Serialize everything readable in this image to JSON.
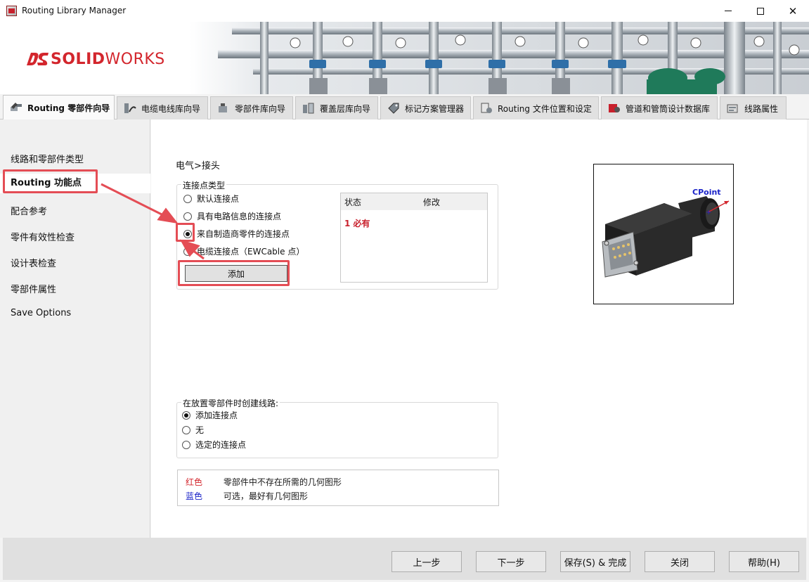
{
  "window": {
    "title": "Routing Library Manager"
  },
  "brand": {
    "logo_bold": "SOLID",
    "logo_light": "WORKS",
    "accent": "#d3262d"
  },
  "tabs": [
    {
      "label": "Routing 零部件向导",
      "icon": "routing-wizard-icon",
      "active": true
    },
    {
      "label": "电缆电线库向导",
      "icon": "cable-library-icon"
    },
    {
      "label": "零部件库向导",
      "icon": "component-library-icon"
    },
    {
      "label": "覆盖层库向导",
      "icon": "covering-library-icon"
    },
    {
      "label": "标记方案管理器",
      "icon": "tag-scheme-icon"
    },
    {
      "label": "Routing 文件位置和设定",
      "icon": "file-location-icon"
    },
    {
      "label": "管道和管筒设计数据库",
      "icon": "pipe-database-icon"
    },
    {
      "label": "线路属性",
      "icon": "route-properties-icon"
    }
  ],
  "sidebar": {
    "items": [
      {
        "label": "线路和零部件类型"
      },
      {
        "label": "Routing 功能点",
        "selected": true
      },
      {
        "label": "配合参考"
      },
      {
        "label": "零件有效性检查"
      },
      {
        "label": "设计表检查"
      },
      {
        "label": "零部件属性"
      },
      {
        "label": "Save Options"
      }
    ]
  },
  "main": {
    "breadcrumb": "电气>接头",
    "connection_type": {
      "legend": "连接点类型",
      "options": [
        {
          "label": "默认连接点",
          "checked": false
        },
        {
          "label": "具有电路信息的连接点",
          "checked": false
        },
        {
          "label": "来自制造商零件的连接点",
          "checked": true
        },
        {
          "label": "电缆连接点（EWCable 点）",
          "checked": false
        }
      ],
      "add_button": "添加"
    },
    "status_table": {
      "col_status": "状态",
      "col_modify": "修改",
      "value": "1 必有",
      "value_color": "#c8202c"
    },
    "preview": {
      "point_label": "CPoint"
    },
    "route_creation": {
      "legend": "在放置零部件时创建线路:",
      "options": [
        {
          "label": "添加连接点",
          "checked": true
        },
        {
          "label": "无",
          "checked": false
        },
        {
          "label": "选定的连接点",
          "checked": false
        }
      ]
    },
    "color_legend": {
      "rows": [
        {
          "key": "红色",
          "desc": "零部件中不存在所需的几何图形",
          "color": "#d3262d"
        },
        {
          "key": "蓝色",
          "desc": "可选，最好有几何图形",
          "color": "#1a23c8"
        }
      ]
    }
  },
  "footer": {
    "back": "上一步",
    "next": "下一步",
    "save_finish": "保存(S) & 完成",
    "close": "关闭",
    "help": "帮助(H)"
  }
}
